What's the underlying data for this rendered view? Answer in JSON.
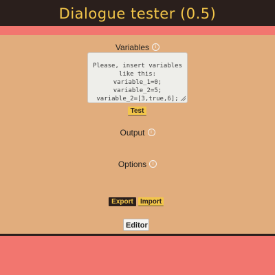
{
  "app": {
    "title": "Dialogue tester (0.5)"
  },
  "variables": {
    "label": "Variables",
    "info_icon": "info-icon",
    "placeholder": "Please, insert variables\nlike this:\nvariable_1=0;\nvariable_2=5;\nvariable_2=[3,true,6];"
  },
  "buttons": {
    "test": "Test",
    "export": "Export",
    "import": "Import",
    "editor": "Editor"
  },
  "output": {
    "label": "Output",
    "info_icon": "info-icon"
  },
  "options": {
    "label": "Options",
    "info_icon": "info-icon"
  },
  "colors": {
    "header_bg": "#2a1f1c",
    "header_text": "#f3c64a",
    "page_bg": "#e1ad7d",
    "accent_pink": "#f2766f"
  }
}
